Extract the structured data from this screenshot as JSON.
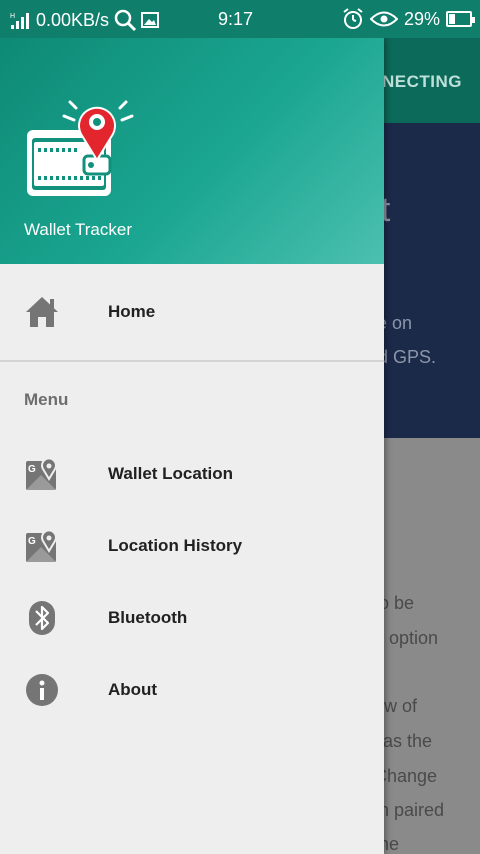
{
  "status_bar": {
    "network": "0.00KB/s",
    "time": "9:17",
    "battery": "29%",
    "battery_level": 0.29
  },
  "background": {
    "toolbar_text": "NECTING",
    "hero_title": "et",
    "hero_line1": "se on",
    "hero_line2": "nd GPS.",
    "body_lines": [
      "to be",
      "h option",
      "ew of",
      "l as the",
      "Change",
      "th paired",
      "the"
    ]
  },
  "drawer": {
    "app_name": "Wallet Tracker",
    "items": [
      {
        "label": "Home",
        "icon": "home-icon"
      },
      {
        "label": "Wallet Location",
        "icon": "map-location-icon"
      },
      {
        "label": "Location History",
        "icon": "map-location-icon"
      },
      {
        "label": "Bluetooth",
        "icon": "bluetooth-icon"
      },
      {
        "label": "About",
        "icon": "info-icon"
      }
    ],
    "section_title": "Menu"
  },
  "colors": {
    "primary": "#0f7f6c",
    "accent": "#1aa691",
    "pin_red": "#e3262e"
  }
}
